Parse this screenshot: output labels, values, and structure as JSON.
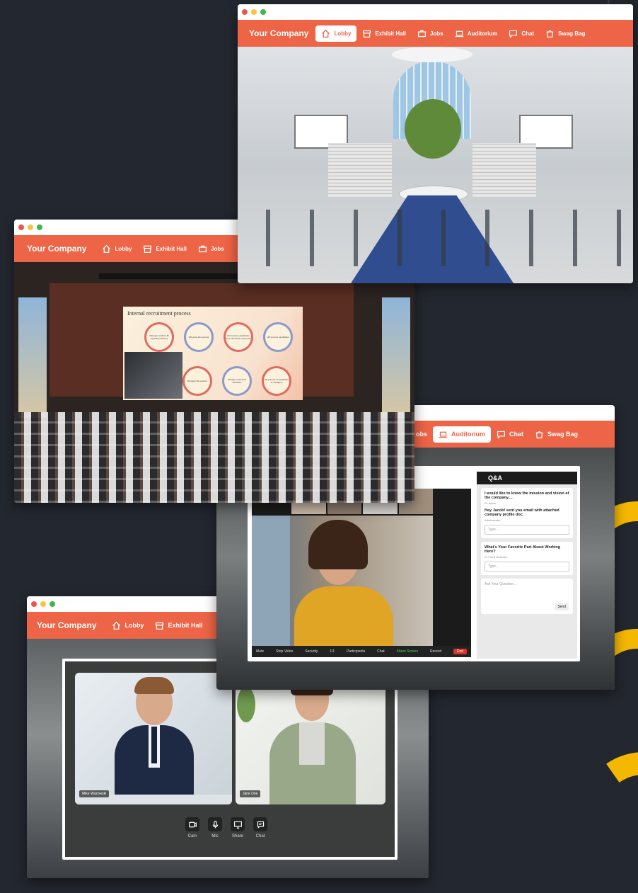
{
  "brand": "Your Company",
  "nav": {
    "lobby": "Lobby",
    "exhibit_hall": "Exhibit Hall",
    "jobs": "Jobs",
    "auditorium": "Auditorium",
    "chat": "Chat",
    "swag_bag": "Swag Bag"
  },
  "nav_partial_jobs": "obs",
  "slide": {
    "title": "Internal recruitment process",
    "steps": [
      "Manager notifies HR regarding vacancy",
      "HR posts job opening",
      "HR receives application from interested employees",
      "HR screens candidates",
      "HR puts list of candidates to managers",
      "Manager interviews candidate",
      "Manager fills position"
    ]
  },
  "qa": {
    "title": "Q&A",
    "messages": [
      {
        "text": "I would like to know the mission and vision of the company....",
        "author": "Dr Jacob"
      },
      {
        "text": "Hey Jacob! sent you email with attached company profile doc.",
        "author": "Adminstrator"
      }
    ],
    "message2": {
      "text": "What's Your Favorite Part About Working Here?",
      "author": "Dr Frank Rearden"
    },
    "type_placeholder": "Type...",
    "ask_placeholder": "Ask Your Question...",
    "send": "Send"
  },
  "meeting_toolbar": {
    "items": [
      "Mute",
      "Stop Video",
      "Security",
      "Participants",
      "Chat",
      "Share Screen",
      "Record"
    ],
    "participants_count": "1/1",
    "end": "End"
  },
  "call": {
    "person1": "Mike Wazowski",
    "person2": "Jane Doe",
    "controls": [
      "Cam",
      "Mic",
      "Share",
      "Chat"
    ]
  },
  "colors": {
    "accent": "#ee6446",
    "background": "#23272f",
    "arc": "#f5b800"
  }
}
